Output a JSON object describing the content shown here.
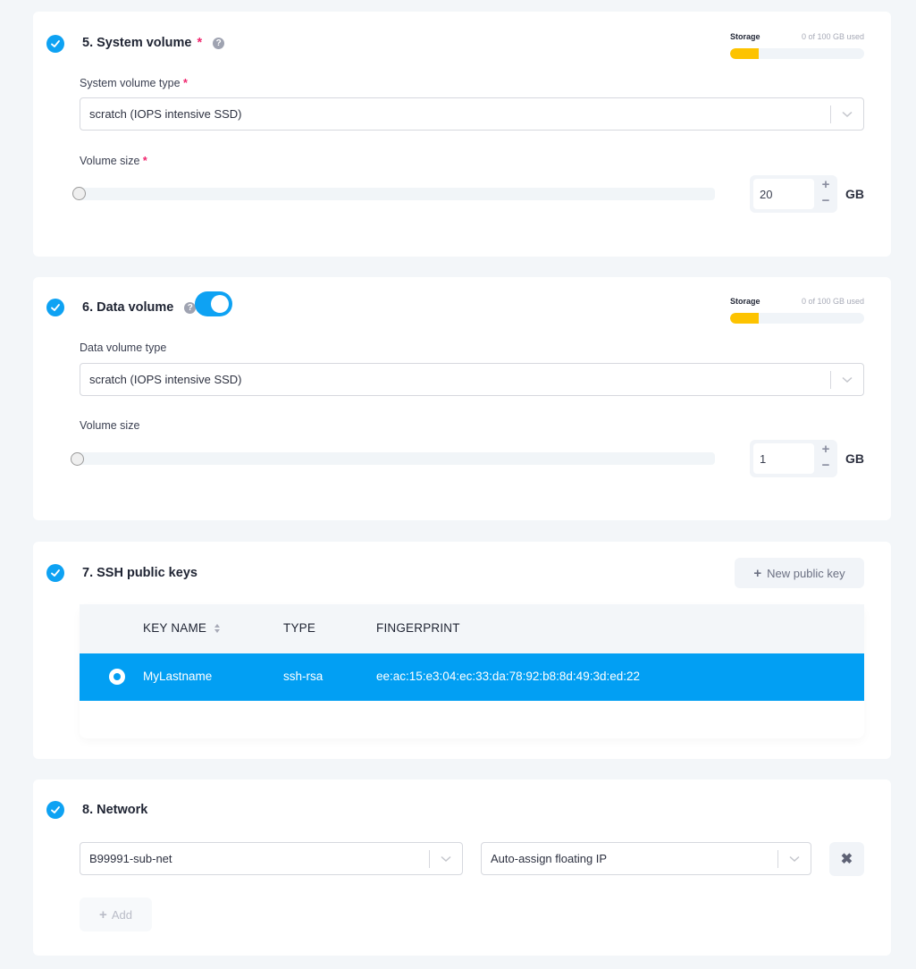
{
  "system_volume": {
    "title": "5. System volume",
    "required_mark": "*",
    "help_icon": "question-circle-icon",
    "storage": {
      "label": "Storage",
      "usage_text": "0 of 100 GB used",
      "fill_percent": 21,
      "fill_color": "#fdc300"
    },
    "type_label": "System volume type",
    "type_value": "scratch (IOPS intensive SSD)",
    "size_label": "Volume size",
    "size_value": "20",
    "slider_fraction": 0,
    "unit": "GB",
    "plus": "+",
    "minus": "−"
  },
  "data_volume": {
    "title": "6. Data volume",
    "help_icon": "question-circle-icon",
    "toggle_on": true,
    "storage": {
      "label": "Storage",
      "usage_text": "0 of 100 GB used",
      "fill_percent": 21,
      "fill_color": "#fdc300"
    },
    "type_label": "Data volume type",
    "type_value": "scratch (IOPS intensive SSD)",
    "size_label": "Volume size",
    "size_value": "1",
    "slider_fraction": 0,
    "unit": "GB",
    "plus": "+",
    "minus": "−"
  },
  "ssh_keys": {
    "title": "7. SSH public keys",
    "new_key_button": "New public key",
    "columns": [
      "KEY NAME",
      "TYPE",
      "FINGERPRINT"
    ],
    "rows": [
      {
        "selected": true,
        "key_name": "MyLastname",
        "type": "ssh-rsa",
        "fingerprint": "ee:ac:15:e3:04:ec:33:da:78:92:b8:8d:49:3d:ed:22"
      }
    ]
  },
  "network": {
    "title": "8. Network",
    "subnet_value": "B99991-sub-net",
    "floating_ip_value": "Auto-assign floating IP",
    "remove_icon": "✖",
    "add_button": "Add"
  },
  "colors": {
    "accent": "#0ea2f3",
    "selected_row": "#029ff3",
    "required": "#f0266e",
    "storage_fill": "#fdc300"
  }
}
